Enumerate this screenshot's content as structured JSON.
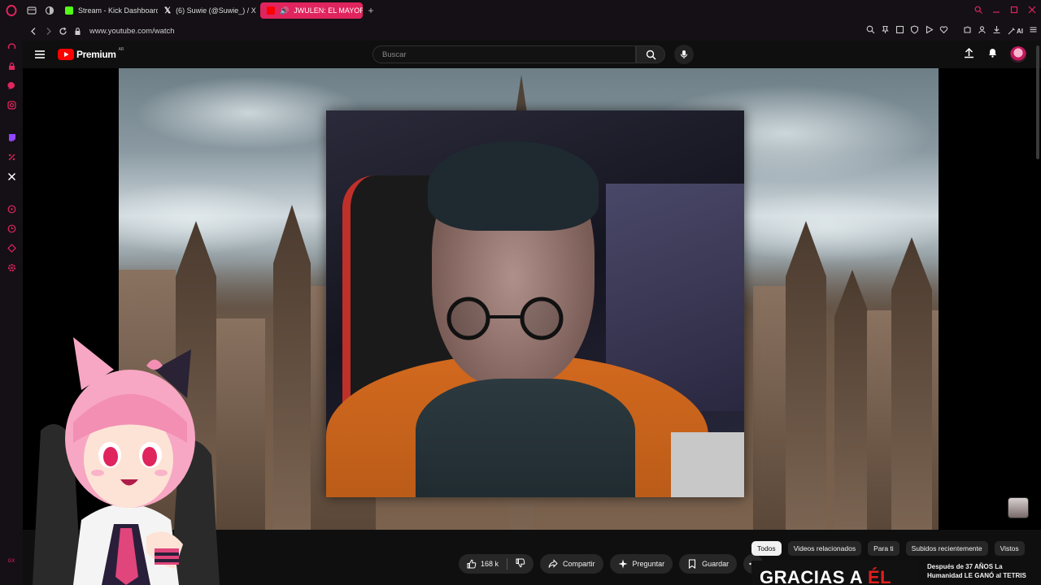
{
  "browser": {
    "tabs": [
      {
        "label": "Stream - Kick Dashboard",
        "favicon_color": "#53fc18"
      },
      {
        "label": "(6) Suwie (@Suwie_) / X",
        "favicon_color": "#ffffff"
      },
      {
        "label": "JWULEN: EL MAYOR F",
        "favicon_color": "#ff0000",
        "active": true
      }
    ],
    "new_tab_glyph": "+",
    "url": "www.youtube.com/watch",
    "ai_label": "AI",
    "accent": "#e0245e"
  },
  "sidebar": {
    "icons": [
      "speed-dial-icon",
      "lock-icon",
      "messenger-icon",
      "instagram-icon",
      "twitch-icon",
      "x-icon",
      "history-icon",
      "clock-icon",
      "music-icon",
      "settings-icon"
    ],
    "bottom_glyph": "GX"
  },
  "youtube": {
    "logo_text": "Premium",
    "region_sup": "AR",
    "search_placeholder": "Buscar",
    "brand_red": "#ff0000"
  },
  "actions": {
    "likes": "168 k",
    "share": "Compartir",
    "ask": "Preguntar",
    "save": "Guardar"
  },
  "chips": [
    "Todos",
    "Videos relacionados",
    "Para ti",
    "Subidos recientemente",
    "Vistos"
  ],
  "recommendation": {
    "thumb_text_white": "GRACIAS A ",
    "thumb_text_red": "ÉL",
    "title": "Después de 37 AÑOS La Humanidad LE GANÓ al TETRIS"
  }
}
